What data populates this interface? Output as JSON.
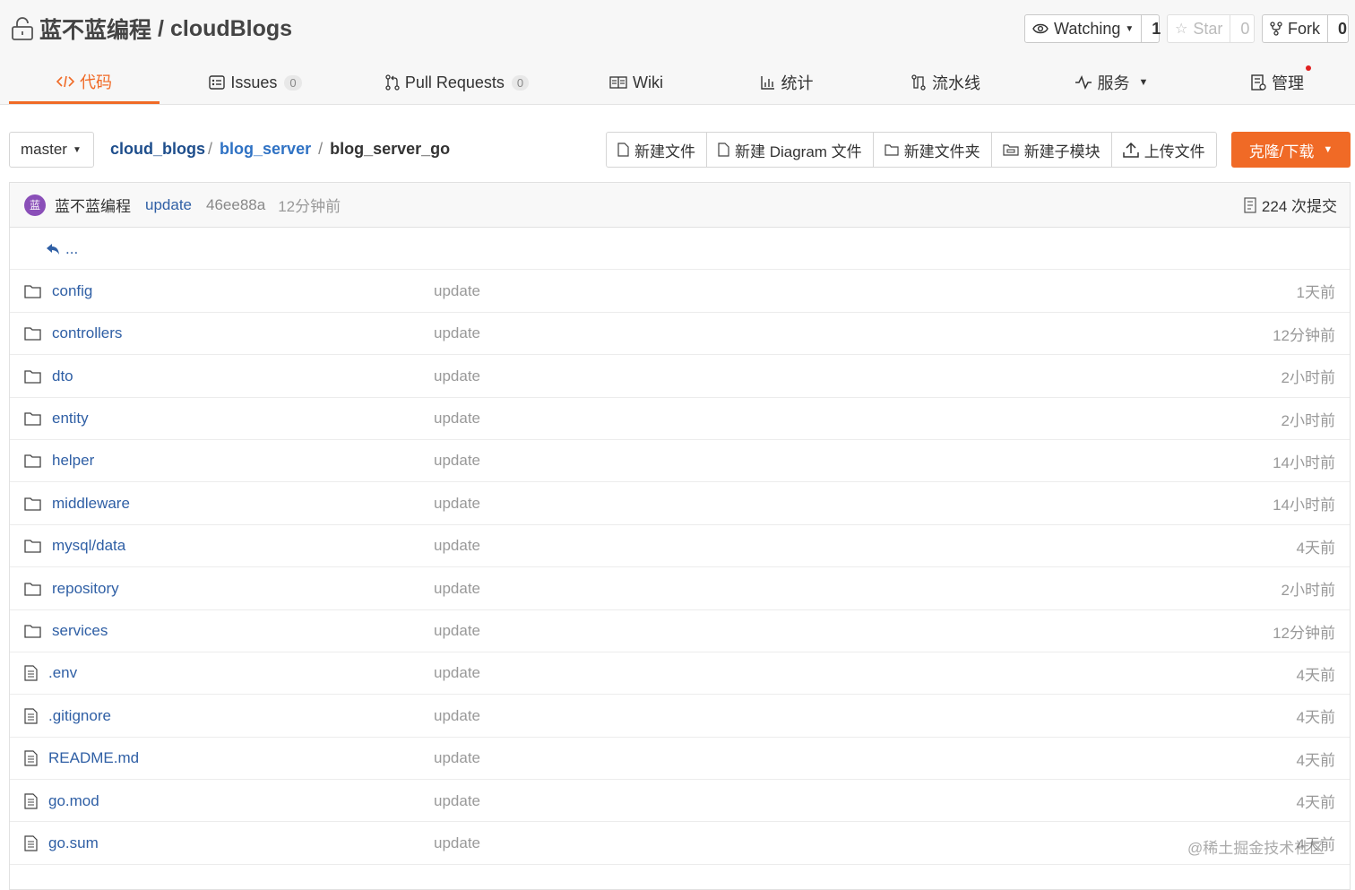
{
  "repo": {
    "owner": "蓝不蓝编程",
    "separator": "/",
    "name": "cloudBlogs"
  },
  "header_buttons": {
    "watch_label": "Watching",
    "watch_count": "1",
    "star_label": "Star",
    "star_count": "0",
    "fork_label": "Fork",
    "fork_count": "0"
  },
  "tabs": [
    {
      "label": "代码",
      "icon": "code-icon",
      "active": true
    },
    {
      "label": "Issues",
      "count": "0",
      "icon": "issues-icon"
    },
    {
      "label": "Pull Requests",
      "count": "0",
      "icon": "pull-request-icon"
    },
    {
      "label": "Wiki",
      "icon": "wiki-icon"
    },
    {
      "label": "统计",
      "icon": "stats-icon"
    },
    {
      "label": "流水线",
      "icon": "pipeline-icon"
    },
    {
      "label": "服务",
      "icon": "service-icon"
    },
    {
      "label": "管理",
      "icon": "manage-icon"
    }
  ],
  "branch": "master",
  "breadcrumb": {
    "root": "cloud_blogs",
    "dir": "blog_server",
    "current": "blog_server_go",
    "sep": "/"
  },
  "toolbar": {
    "new_file": "新建文件",
    "new_diagram": "新建 Diagram 文件",
    "new_folder": "新建文件夹",
    "new_submodule": "新建子模块",
    "upload": "上传文件",
    "clone": "克隆/下载"
  },
  "commit": {
    "avatar": "蓝",
    "author": "蓝不蓝编程",
    "message": "update",
    "hash": "46ee88a",
    "time": "12分钟前",
    "count": "224 次提交"
  },
  "parent_link": "...",
  "files": [
    {
      "type": "folder",
      "name": "config",
      "message": "update",
      "time": "1天前"
    },
    {
      "type": "folder",
      "name": "controllers",
      "message": "update",
      "time": "12分钟前"
    },
    {
      "type": "folder",
      "name": "dto",
      "message": "update",
      "time": "2小时前"
    },
    {
      "type": "folder",
      "name": "entity",
      "message": "update",
      "time": "2小时前"
    },
    {
      "type": "folder",
      "name": "helper",
      "message": "update",
      "time": "14小时前"
    },
    {
      "type": "folder",
      "name": "middleware",
      "message": "update",
      "time": "14小时前"
    },
    {
      "type": "folder",
      "name": "mysql/data",
      "message": "update",
      "time": "4天前"
    },
    {
      "type": "folder",
      "name": "repository",
      "message": "update",
      "time": "2小时前"
    },
    {
      "type": "folder",
      "name": "services",
      "message": "update",
      "time": "12分钟前"
    },
    {
      "type": "file",
      "name": ".env",
      "message": "update",
      "time": "4天前"
    },
    {
      "type": "file",
      "name": ".gitignore",
      "message": "update",
      "time": "4天前"
    },
    {
      "type": "file",
      "name": "README.md",
      "message": "update",
      "time": "4天前"
    },
    {
      "type": "file",
      "name": "go.mod",
      "message": "update",
      "time": "4天前"
    },
    {
      "type": "file",
      "name": "go.sum",
      "message": "update",
      "time": "4天前"
    }
  ],
  "watermark": "@稀土掘金技术社区",
  "colors": {
    "accent": "#f06a26",
    "link": "#2f5fa5",
    "avatar": "#8a4fb8"
  }
}
